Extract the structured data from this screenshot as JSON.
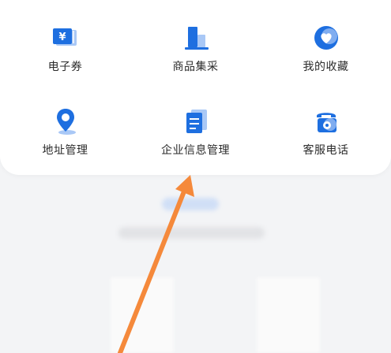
{
  "menu": {
    "items": [
      {
        "label": "电子券",
        "icon": "coupon-icon"
      },
      {
        "label": "商品集采",
        "icon": "building-icon"
      },
      {
        "label": "我的收藏",
        "icon": "favorite-heart-icon"
      },
      {
        "label": "地址管理",
        "icon": "location-pin-icon"
      },
      {
        "label": "企业信息管理",
        "icon": "document-icon"
      },
      {
        "label": "客服电话",
        "icon": "telephone-icon"
      }
    ]
  },
  "colors": {
    "accent": "#1e6fe0",
    "accent_light": "#a9c8f6",
    "annotation_arrow": "#f5893b"
  }
}
